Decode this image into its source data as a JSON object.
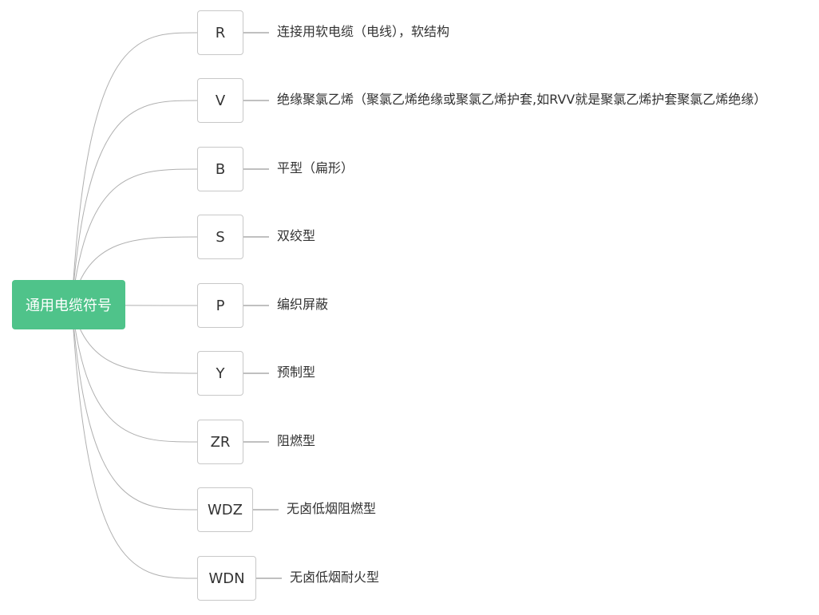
{
  "root": {
    "label": "通用电缆符号"
  },
  "branches": [
    {
      "code": "R",
      "description": "连接用软电缆（电线），软结构"
    },
    {
      "code": "V",
      "description": "绝缘聚氯乙烯（聚氯乙烯绝缘或聚氯乙烯护套,如RVV就是聚氯乙烯护套聚氯乙烯绝缘）"
    },
    {
      "code": "B",
      "description": "平型（扁形）"
    },
    {
      "code": "S",
      "description": "双绞型"
    },
    {
      "code": "P",
      "description": "编织屏蔽"
    },
    {
      "code": "Y",
      "description": "预制型"
    },
    {
      "code": "ZR",
      "description": "阻燃型"
    },
    {
      "code": "WDZ",
      "description": "无卤低烟阻燃型"
    },
    {
      "code": "WDN",
      "description": "无卤低烟耐火型"
    }
  ],
  "colors": {
    "root_fill": "#4fc38a",
    "connector": "#b0b0b0",
    "node_border": "#c8c8c8"
  }
}
